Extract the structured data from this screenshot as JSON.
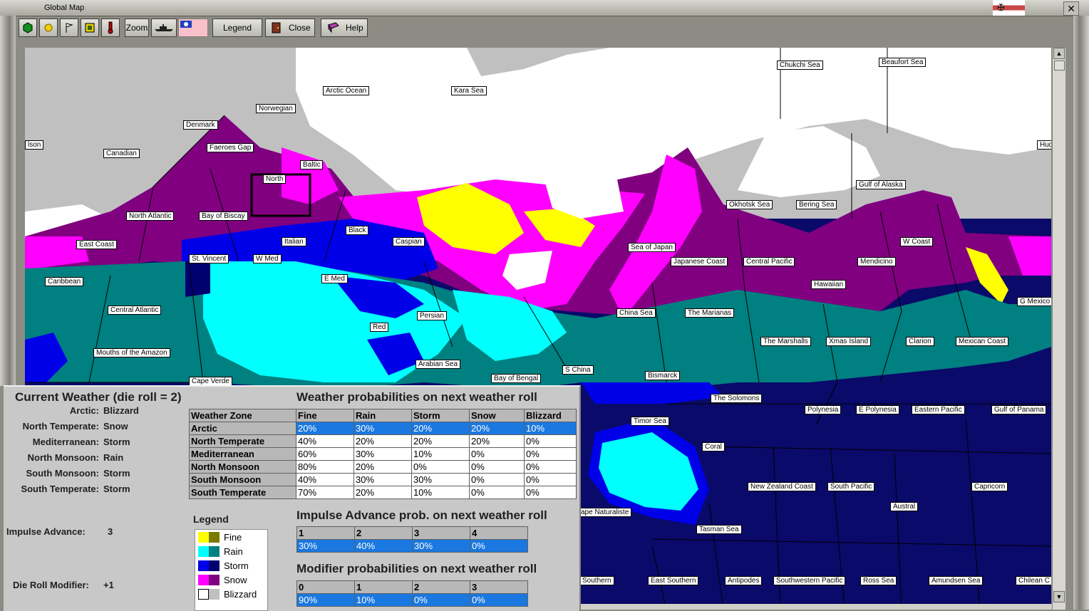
{
  "window": {
    "title": "Global Map"
  },
  "toolbar": {
    "zoom_label": "Zoom",
    "legend_label": "Legend",
    "close_label": "Close",
    "help_label": "Help"
  },
  "map_labels": [
    "Chukchi Sea",
    "Beaufort Sea",
    "Arctic Ocean",
    "Kara Sea",
    "Norwegian",
    "Denmark",
    "Faeroes Gap",
    "Baltic",
    "Canadian",
    "lson",
    "Hud",
    "North",
    "North Atlantic",
    "Bay of Biscay",
    "Black",
    "East Coast",
    "Italian",
    "Caspian",
    "St. Vincent",
    "W Med",
    "E Med",
    "Caribbean",
    "Central Atlantic",
    "Persian",
    "Red",
    "Mouths of the Amazon",
    "Arabian Sea",
    "Cape Verde",
    "Bay of Bengal",
    "S China",
    "Bismarck",
    "Sea of Japan",
    "Japanese Coast",
    "Central Pacific",
    "Okhotsk Sea",
    "Bering Sea",
    "Gulf of Alaska",
    "W Coast",
    "Mendicino",
    "Hawaiian",
    "China Sea",
    "The Marianas",
    "The Marshalls",
    "Xmas Island",
    "Clarion",
    "Mexican Coast",
    "G Mexico",
    "The Solomons",
    "Polynesia",
    "E Polynesia",
    "Eastern Pacific",
    "Gulf of Panama",
    "Timor Sea",
    "Coral",
    "New Zealand Coast",
    "South Pacific",
    "Capricorn",
    "Austral",
    "ape Naturaliste",
    "Tasman Sea",
    "Southern",
    "East Southern",
    "Antipodes",
    "Southwestern Pacific",
    "Ross Sea",
    "Amundsen Sea",
    "Chilean C"
  ],
  "current": {
    "heading": "Current Weather (die roll = 2)",
    "rows": [
      {
        "zone": "Arctic:",
        "value": "Blizzard"
      },
      {
        "zone": "North Temperate:",
        "value": "Snow"
      },
      {
        "zone": "Mediterranean:",
        "value": "Storm"
      },
      {
        "zone": "North Monsoon:",
        "value": "Rain"
      },
      {
        "zone": "South Monsoon:",
        "value": "Storm"
      },
      {
        "zone": "South Temperate:",
        "value": "Storm"
      }
    ],
    "impulse_label": "Impulse Advance:",
    "impulse_value": "3",
    "modifier_label": "Die Roll Modifier:",
    "modifier_value": "+1"
  },
  "weather_prob": {
    "heading": "Weather probabilities on next weather roll",
    "headers": [
      "Weather Zone",
      "Fine",
      "Rain",
      "Storm",
      "Snow",
      "Blizzard"
    ],
    "rows": [
      [
        "Arctic",
        "20%",
        "30%",
        "20%",
        "20%",
        "10%"
      ],
      [
        "North Temperate",
        "40%",
        "20%",
        "20%",
        "20%",
        "0%"
      ],
      [
        "Mediterranean",
        "60%",
        "30%",
        "10%",
        "0%",
        "0%"
      ],
      [
        "North Monsoon",
        "80%",
        "20%",
        "0%",
        "0%",
        "0%"
      ],
      [
        "South Monsoon",
        "40%",
        "30%",
        "30%",
        "0%",
        "0%"
      ],
      [
        "South Temperate",
        "70%",
        "20%",
        "10%",
        "0%",
        "0%"
      ]
    ]
  },
  "impulse_prob": {
    "heading": "Impulse Advance prob. on next weather roll",
    "headers": [
      "1",
      "2",
      "3",
      "4"
    ],
    "values": [
      "30%",
      "40%",
      "30%",
      "0%"
    ]
  },
  "modifier_prob": {
    "heading": "Modifier probabilities on next weather roll",
    "headers": [
      "0",
      "1",
      "2",
      "3"
    ],
    "values": [
      "90%",
      "10%",
      "0%",
      "0%"
    ]
  },
  "legend": {
    "title": "Legend",
    "items": [
      {
        "label": "Fine",
        "c1": "#ffff00",
        "c2": "#7a7a00"
      },
      {
        "label": "Rain",
        "c1": "#00ffff",
        "c2": "#008080"
      },
      {
        "label": "Storm",
        "c1": "#0000e8",
        "c2": "#000070"
      },
      {
        "label": "Snow",
        "c1": "#ff00ff",
        "c2": "#800080"
      },
      {
        "label": "Blizzard",
        "c1": "#ffffff",
        "c2": "#c0c0c0"
      }
    ]
  }
}
